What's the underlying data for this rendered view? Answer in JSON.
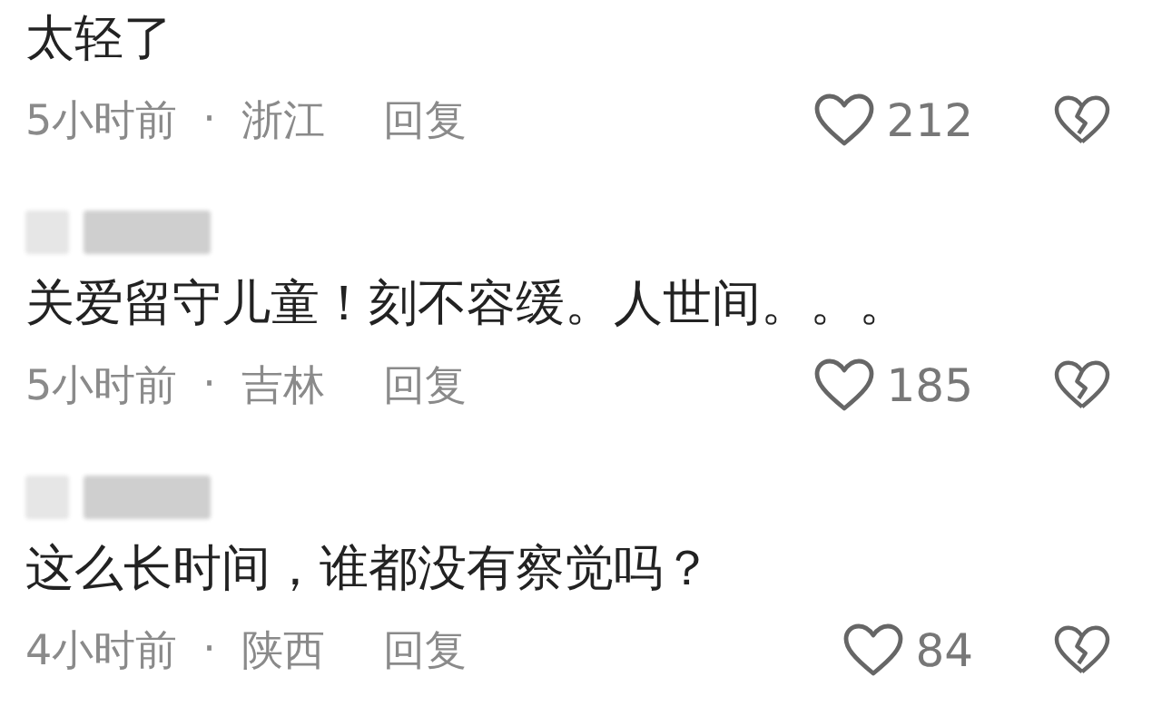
{
  "comments": [
    {
      "user_shown": false,
      "text": "太轻了",
      "time": "5小时前",
      "separator": "·",
      "location": "浙江",
      "reply": "回复",
      "likes": "212"
    },
    {
      "user_shown": true,
      "text": "关爱留守儿童！刻不容缓。人世间。。。",
      "time": "5小时前",
      "separator": "·",
      "location": "吉林",
      "reply": "回复",
      "likes": "185"
    },
    {
      "user_shown": true,
      "text": "这么长时间，谁都没有察觉吗？",
      "time": "4小时前",
      "separator": "·",
      "location": "陕西",
      "reply": "回复",
      "likes": "84"
    }
  ]
}
